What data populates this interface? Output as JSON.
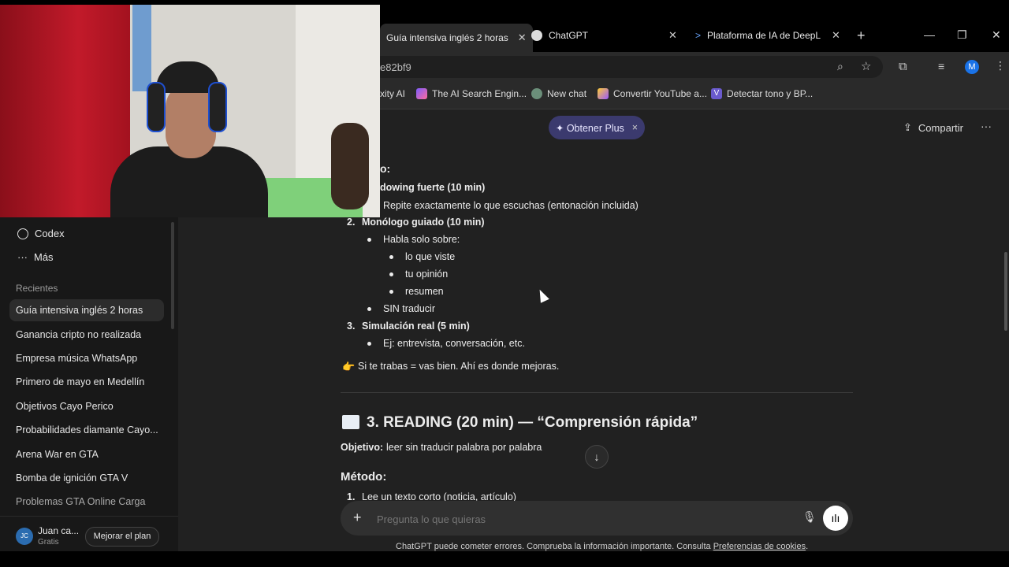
{
  "browser": {
    "tabs": [
      {
        "label": "Guía intensiva inglés 2 horas",
        "active": true
      },
      {
        "label": "ChatGPT",
        "active": false
      },
      {
        "label": "Plataforma de IA de DeepL",
        "active": false
      }
    ],
    "new_tab": "+",
    "url": "e82bf9",
    "profile_initial": "M",
    "bookmarks": [
      {
        "label": "xity AI"
      },
      {
        "label": "The AI Search Engin..."
      },
      {
        "label": "New chat"
      },
      {
        "label": "Convertir YouTube a..."
      },
      {
        "label": "Detectar tono y BP..."
      }
    ],
    "window_controls": {
      "minimize": "—",
      "restore": "❐",
      "close": "✕"
    }
  },
  "topbar": {
    "plus_label": "✦ Obtener Plus",
    "plus_close": "×",
    "share_label": "Compartir",
    "more": "···"
  },
  "sidebar": {
    "codex": "Codex",
    "more": "Más",
    "recents_heading": "Recientes",
    "items": [
      {
        "label": "Guía intensiva inglés 2 horas",
        "active": true
      },
      {
        "label": "Ganancia cripto no realizada"
      },
      {
        "label": "Empresa música WhatsApp"
      },
      {
        "label": "Primero de mayo en Medellín"
      },
      {
        "label": "Objetivos Cayo Perico"
      },
      {
        "label": "Probabilidades diamante Cayo..."
      },
      {
        "label": "Arena War en GTA"
      },
      {
        "label": "Bomba de ignición GTA V"
      },
      {
        "label": "Problemas GTA Online Carga"
      }
    ],
    "user": {
      "initials": "JC",
      "name": "Juan ca...",
      "plan": "Gratis",
      "upgrade": "Mejorar el plan"
    }
  },
  "content": {
    "partial_heading": "o:",
    "item1_title": "dowing fuerte (10 min)",
    "item1_bullet": "Repite exactamente lo que escuchas (entonación incluida)",
    "item2_num": "2.",
    "item2_title": "Monólogo guiado (10 min)",
    "item2_bullet": "Habla solo sobre:",
    "item2_sub": [
      "lo que viste",
      "tu opinión",
      "resumen"
    ],
    "item2_bullet2": "SIN traducir",
    "item3_num": "3.",
    "item3_title": "Simulación real (5 min)",
    "item3_bullet": "Ej: entrevista, conversación, etc.",
    "tip": "Si te trabas = vas bien. Ahí es donde mejoras.",
    "reading_heading": "3. READING (20 min) — “Comprensión rápida”",
    "objective_label": "Objetivo:",
    "objective_text": "leer sin traducir palabra por palabra",
    "method_heading": "Método:",
    "method_item1_num": "1.",
    "method_item1": "Lee un texto corto (noticia, artículo)"
  },
  "composer": {
    "placeholder": "Pregunta lo que quieras"
  },
  "footer": {
    "disclaimer": "ChatGPT puede cometer errores. Comprueba la información importante. Consulta ",
    "link": "Preferencias de cookies",
    "end": "."
  },
  "colors": {
    "main_bg": "#212121",
    "sidebar_bg": "#181818",
    "plus_bg": "#3b3a6e",
    "chrome_bg": "#2a2a2a"
  }
}
